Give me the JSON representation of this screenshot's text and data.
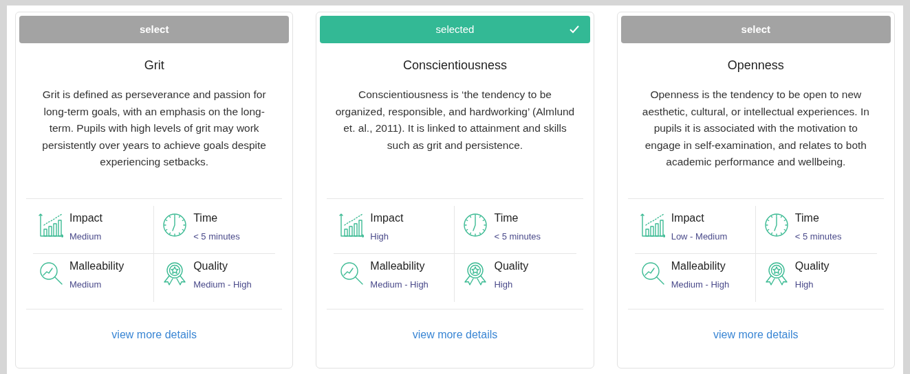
{
  "cards": [
    {
      "button": {
        "label": "select",
        "selected": false
      },
      "title": "Grit",
      "description": "Grit is defined as perseverance and passion for long-term goals, with an emphasis on the long-term. Pupils with high levels of grit may work persistently over years to achieve goals despite experiencing setbacks.",
      "metrics": [
        {
          "kind": "impact",
          "label": "Impact",
          "value": "Medium"
        },
        {
          "kind": "time",
          "label": "Time",
          "value": "< 5 minutes"
        },
        {
          "kind": "malleability",
          "label": "Malleability",
          "value": "Medium"
        },
        {
          "kind": "quality",
          "label": "Quality",
          "value": "Medium - High"
        }
      ],
      "link": "view more details"
    },
    {
      "button": {
        "label": "selected",
        "selected": true
      },
      "title": "Conscientiousness",
      "description": "Conscientiousness is ‘the tendency to be organized, responsible, and hardworking’ (Almlund et. al., 2011). It is linked to attainment and skills such as grit and persistence.",
      "metrics": [
        {
          "kind": "impact",
          "label": "Impact",
          "value": "High"
        },
        {
          "kind": "time",
          "label": "Time",
          "value": "< 5 minutes"
        },
        {
          "kind": "malleability",
          "label": "Malleability",
          "value": "Medium - High"
        },
        {
          "kind": "quality",
          "label": "Quality",
          "value": "High"
        }
      ],
      "link": "view more details"
    },
    {
      "button": {
        "label": "select",
        "selected": false
      },
      "title": "Openness",
      "description": "Openness is the tendency to be open to new aesthetic, cultural, or intellectual experiences. In pupils it is associated with the motivation to engage in self-examination, and relates to both academic performance and wellbeing.",
      "metrics": [
        {
          "kind": "impact",
          "label": "Impact",
          "value": "Low - Medium"
        },
        {
          "kind": "time",
          "label": "Time",
          "value": "< 5 minutes"
        },
        {
          "kind": "malleability",
          "label": "Malleability",
          "value": "Medium - High"
        },
        {
          "kind": "quality",
          "label": "Quality",
          "value": "High"
        }
      ],
      "link": "view more details"
    }
  ]
}
